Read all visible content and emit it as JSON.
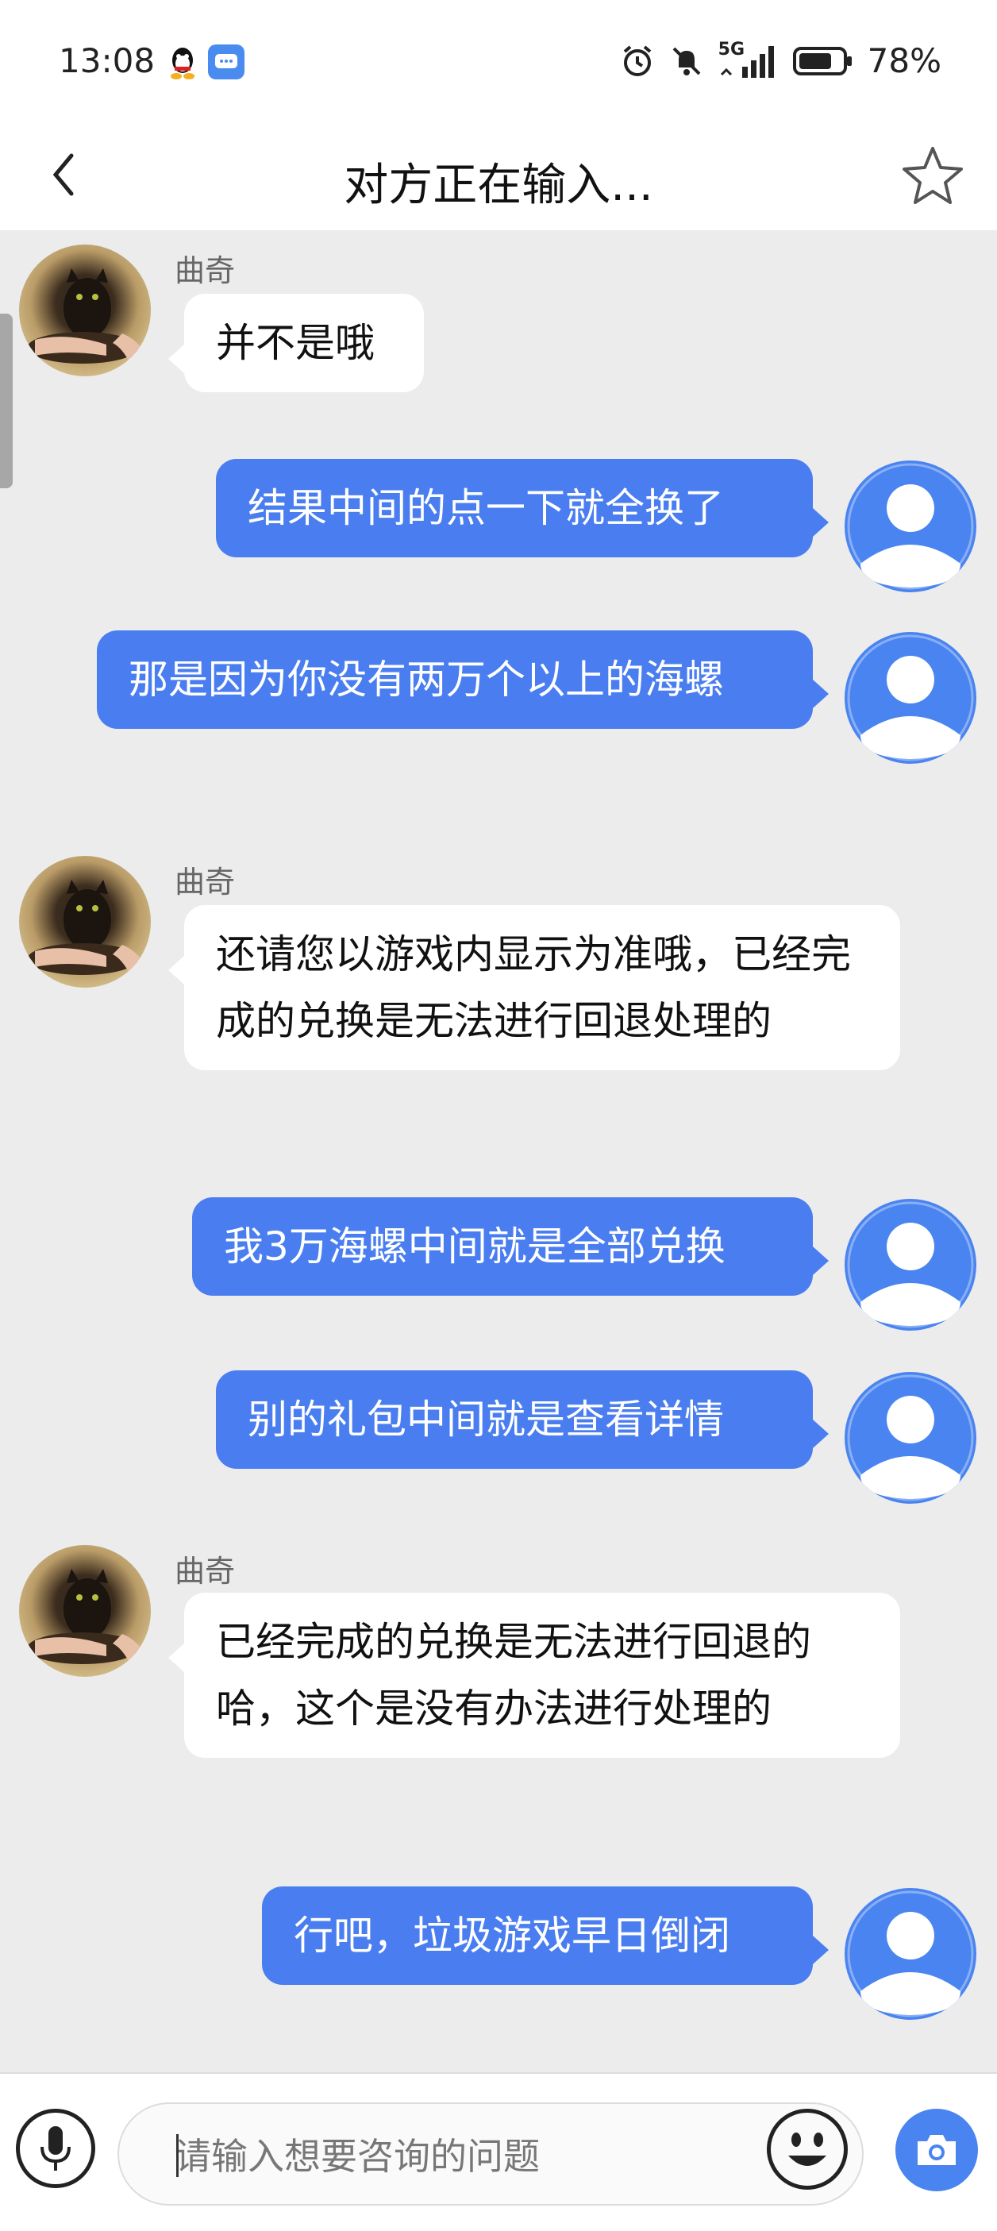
{
  "status_bar": {
    "time": "13:08",
    "network": "5G",
    "battery": "78%",
    "icons": [
      "qq-icon",
      "message-icon",
      "alarm-icon",
      "mute-icon",
      "signal-icon",
      "battery-icon"
    ]
  },
  "header": {
    "title": "对方正在输入...",
    "back_icon": "chevron-left-icon",
    "star_icon": "star-outline-icon"
  },
  "messages": [
    {
      "side": "in",
      "sender": "曲奇",
      "text": "并不是哦"
    },
    {
      "side": "out",
      "text": "结果中间的点一下就全换了"
    },
    {
      "side": "out",
      "text": "那是因为你没有两万个以上的海螺"
    },
    {
      "side": "in",
      "sender": "曲奇",
      "text": "还请您以游戏内显示为准哦，已经完成的兑换是无法进行回退处理的"
    },
    {
      "side": "out",
      "text": "我3万海螺中间就是全部兑换"
    },
    {
      "side": "out",
      "text": "别的礼包中间就是查看详情"
    },
    {
      "side": "in",
      "sender": "曲奇",
      "text": "已经完成的兑换是无法进行回退的哈，这个是没有办法进行处理的"
    },
    {
      "side": "out",
      "text": "行吧，垃圾游戏早日倒闭"
    }
  ],
  "input_bar": {
    "placeholder": "请输入想要咨询的问题",
    "mic_icon": "microphone-icon",
    "emoji_icon": "emoji-icon",
    "camera_icon": "camera-icon"
  },
  "colors": {
    "outgoing_bubble": "#4a7ef0",
    "incoming_bubble": "#ffffff",
    "chat_background": "#ececec",
    "user_avatar": "#4a84f0"
  }
}
